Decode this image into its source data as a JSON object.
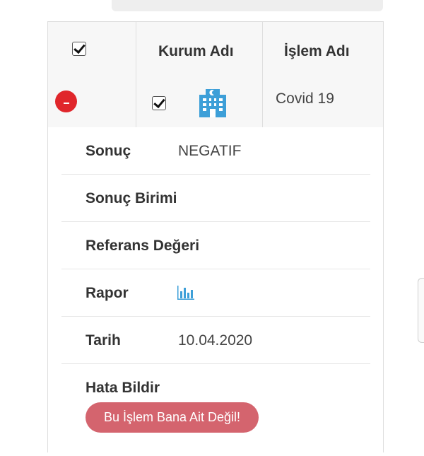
{
  "table": {
    "headers": {
      "kurum": "Kurum Adı",
      "islem": "İşlem Adı"
    },
    "row": {
      "islem_adi": "Covid 19",
      "selected": true
    }
  },
  "details": {
    "sonuc": {
      "label": "Sonuç",
      "value": "NEGATIF"
    },
    "sonuc_birimi": {
      "label": "Sonuç Birimi",
      "value": ""
    },
    "referans": {
      "label": "Referans Değeri",
      "value": ""
    },
    "rapor": {
      "label": "Rapor",
      "icon": "bar-chart-icon"
    },
    "tarih": {
      "label": "Tarih",
      "value": "10.04.2020"
    },
    "hata": {
      "label": "Hata Bildir",
      "button_label": "Bu İşlem Bana Ait Değil!"
    }
  },
  "colors": {
    "accent_blue": "#3d9fd8",
    "remove_red": "#e0262b",
    "report_button": "#d4646e"
  }
}
